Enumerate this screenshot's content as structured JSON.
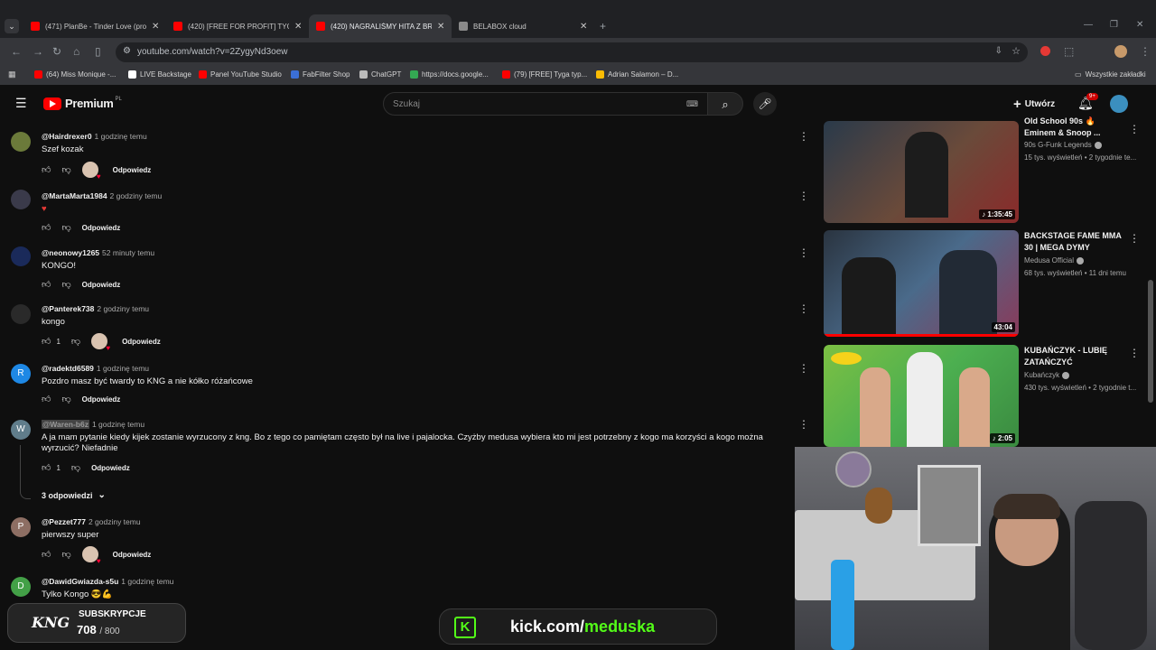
{
  "browser": {
    "tabs": [
      {
        "title": "(471) PlanBe - Tinder Love (pro...",
        "favicon_color": "#ff0000"
      },
      {
        "title": "(420) [FREE FOR PROFIT] TYGA...",
        "favicon_color": "#ff0000"
      },
      {
        "title": "(420) NAGRALIŚMY HITA Z BRO...",
        "favicon_color": "#ff0000"
      },
      {
        "title": "BELABOX cloud",
        "favicon_color": "#8a8a8a"
      }
    ],
    "url": "youtube.com/watch?v=2ZygyNd3oew",
    "bookmarks": [
      {
        "label": "(64) Miss Monique -...",
        "color": "#ff0000"
      },
      {
        "label": "LIVE Backstage",
        "color": "#ffffff"
      },
      {
        "label": "Panel YouTube Studio",
        "color": "#ff0000"
      },
      {
        "label": "FabFilter Shop",
        "color": "#3b6fd6"
      },
      {
        "label": "ChatGPT",
        "color": "#bbbbbb"
      },
      {
        "label": "https://docs.google...",
        "color": "#34a853"
      },
      {
        "label": "(79) [FREE] Tyga typ...",
        "color": "#ff0000"
      },
      {
        "label": "Adrian Salamon – D...",
        "color": "#fbbc04"
      }
    ],
    "all_bookmarks": "Wszystkie zakładki"
  },
  "youtube": {
    "logo": "Premium",
    "logo_region": "PL",
    "search_placeholder": "Szukaj",
    "create_label": "Utwórz",
    "notif_badge": "9+"
  },
  "comments": [
    {
      "author": "@Hairdrexer0",
      "time": "1 godzinę temu",
      "text": "Szef kozak",
      "likes": "",
      "reply": "Odpowiedz",
      "avatar_letter": "",
      "avatar_color": "#6b7a3a",
      "hearted": true
    },
    {
      "author": "@MartaMarta1984",
      "time": "2 godziny temu",
      "text": "♥",
      "likes": "",
      "reply": "Odpowiedz",
      "avatar_letter": "",
      "avatar_color": "#3a3a4a",
      "hearted": false
    },
    {
      "author": "@neonowy1265",
      "time": "52 minuty temu",
      "text": "KONGO!",
      "likes": "",
      "reply": "Odpowiedz",
      "avatar_letter": "",
      "avatar_color": "#1a2a5a",
      "hearted": false
    },
    {
      "author": "@Panterek738",
      "time": "2 godziny temu",
      "text": "kongo",
      "likes": "1",
      "reply": "Odpowiedz",
      "avatar_letter": "",
      "avatar_color": "#2a2a2a",
      "hearted": true
    },
    {
      "author": "@radektd6589",
      "time": "1 godzinę temu",
      "text": "Pozdro masz być twardy to KNG a nie kółko różańcowe",
      "likes": "",
      "reply": "Odpowiedz",
      "avatar_letter": "R",
      "avatar_color": "#1e88e5",
      "hearted": false
    },
    {
      "author": "@Waren-b6z",
      "time": "1 godzinę temu",
      "text": "A ja mam pytanie kiedy kijek zostanie wyrzucony z kng. Bo z tego co pamiętam często był na live i pajalocka. Czyżby medusa wybiera kto mi jest potrzebny z kogo ma korzyści a kogo można wyrzucić? Niefadnie",
      "likes": "1",
      "reply": "Odpowiedz",
      "avatar_letter": "W",
      "avatar_color": "#607d8b",
      "hearted": false
    },
    {
      "author": "@Pezzet777",
      "time": "2 godziny temu",
      "text": "pierwszy super",
      "likes": "",
      "reply": "Odpowiedz",
      "avatar_letter": "P",
      "avatar_color": "#8d6e63",
      "hearted": true
    },
    {
      "author": "@DawidGwiazda-s5u",
      "time": "1 godzinę temu",
      "text": "Tylko Kongo 😎💪",
      "likes": "",
      "reply": "Odpowiedz",
      "avatar_letter": "D",
      "avatar_color": "#43a047",
      "hearted": false
    }
  ],
  "replies_toggle": "3 odpowiedzi",
  "sidebar": [
    {
      "title": "Old School 90s 🔥 Eminem & Snoop ...",
      "channel": "90s G-Funk Legends",
      "meta": "15 tys. wyświetleń • 2 tygodnie te...",
      "duration": "1:35:45",
      "thumb_color": "#5a4a3a"
    },
    {
      "title": "BACKSTAGE FAME MMA 30 | MEGA DYMY",
      "channel": "Medusa Official",
      "meta": "68 tys. wyświetleń • 11 dni temu",
      "duration": "43:04",
      "thumb_color": "#3a4a5a"
    },
    {
      "title": "KUBAŃCZYK - LUBIĘ ZATAŃCZYĆ",
      "channel": "Kubańczyk",
      "meta": "430 tys. wyświetleń • 2 tygodnie t...",
      "duration": "2:05",
      "thumb_color": "#4caf50"
    }
  ],
  "overlay": {
    "sub_label": "SUBSKRYPCJE",
    "sub_current": "708",
    "sub_goal": "/ 800",
    "sub_logo": "KNG",
    "kick_prefix": "kick.com/",
    "kick_name": "meduska"
  }
}
